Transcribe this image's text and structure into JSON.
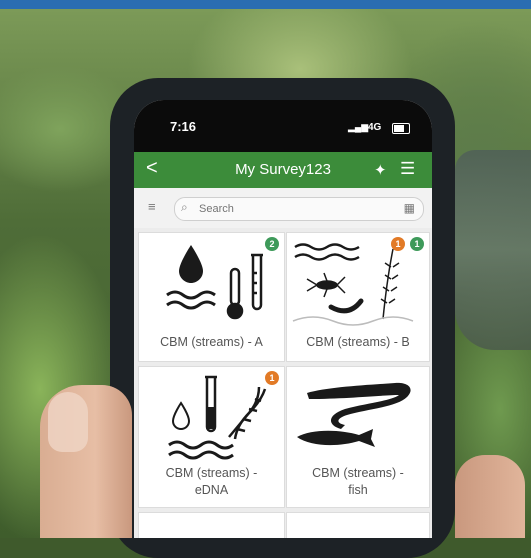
{
  "status_bar": {
    "time": "7:16",
    "signal": "▂▄▆",
    "network": "4G"
  },
  "app_bar": {
    "back_glyph": "<",
    "title": "My Survey123",
    "gps_glyph": "✦",
    "menu_glyph": "☰"
  },
  "search": {
    "sort_glyph": "≡",
    "search_glyph": "⌕",
    "placeholder": "Search",
    "qr_glyph": "▦"
  },
  "surveys": [
    {
      "label": "CBM (streams) - A",
      "badges": [
        {
          "count": "2",
          "color": "#3e9a5a"
        }
      ]
    },
    {
      "label": "CBM (streams) - B",
      "badges": [
        {
          "count": "1",
          "color": "#e27a26"
        },
        {
          "count": "1",
          "color": "#3e9a5a"
        }
      ]
    },
    {
      "label": "CBM (streams) -\neDNA",
      "badges": [
        {
          "count": "1",
          "color": "#e27a26"
        }
      ]
    },
    {
      "label": "CBM (streams) -\nfish",
      "badges": []
    }
  ],
  "icons": {
    "card_a": [
      "water-drop-icon",
      "waves-icon",
      "thermometer-icon",
      "test-tube-icon"
    ],
    "card_b": [
      "waves-icon",
      "insect-icon",
      "worm-icon",
      "aquatic-plant-icon"
    ],
    "card_edna": [
      "water-drop-icon",
      "test-tube-icon",
      "dna-icon",
      "waves-icon"
    ],
    "card_fish": [
      "eel-icon",
      "fish-icon"
    ]
  },
  "colors": {
    "app_bar": "#3c8c3a",
    "badge_green": "#3e9a5a",
    "badge_orange": "#e27a26"
  }
}
